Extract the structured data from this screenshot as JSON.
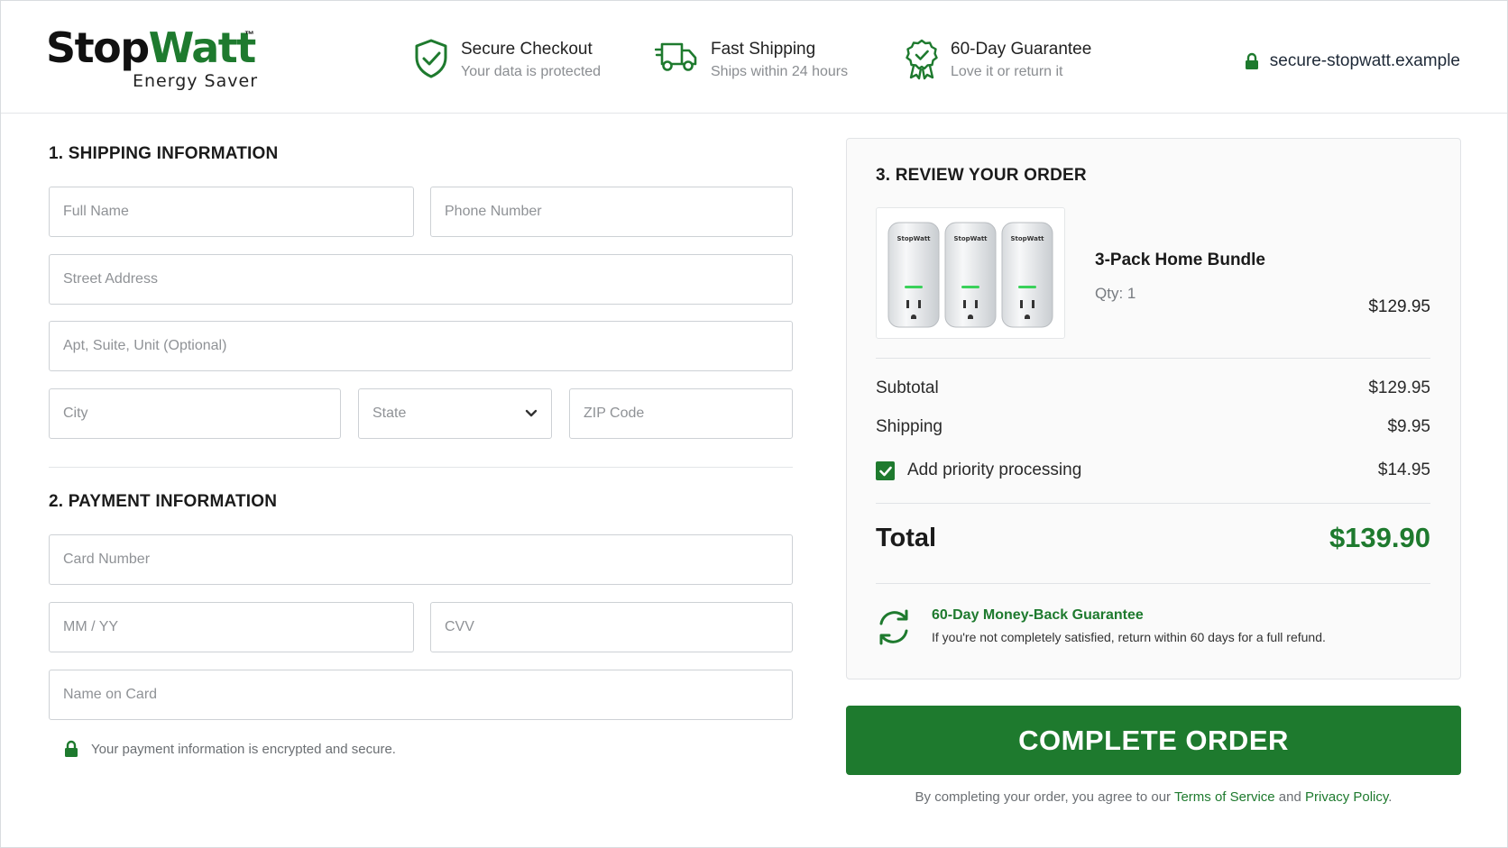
{
  "brand": {
    "logo_stop": "Stop",
    "logo_watt": "Watt",
    "logo_tm": "™",
    "logo_sub": "Energy Saver",
    "accent_color": "#1e7a2e"
  },
  "header": {
    "features": [
      {
        "icon": "shield-check-icon",
        "title": "Secure Checkout",
        "subtitle": "Your data is protected"
      },
      {
        "icon": "truck-icon",
        "title": "Fast Shipping",
        "subtitle": "Ships within 24 hours"
      },
      {
        "icon": "award-badge-icon",
        "title": "60-Day Guarantee",
        "subtitle": "Love it or return it"
      }
    ],
    "secure_url": "secure-stopwatt.example"
  },
  "shipping": {
    "heading": "1. SHIPPING INFORMATION",
    "full_name_placeholder": "Full Name",
    "phone_placeholder": "Phone Number",
    "street_placeholder": "Street Address",
    "apt_placeholder": "Apt, Suite, Unit (Optional)",
    "city_placeholder": "City",
    "state_value": "State",
    "zip_placeholder": "ZIP Code"
  },
  "payment": {
    "heading": "2. PAYMENT INFORMATION",
    "card_placeholder": "Card Number",
    "expiry_placeholder": "MM / YY",
    "cvv_placeholder": "CVV",
    "name_on_card_placeholder": "Name on Card",
    "secure_note": "Your payment information is encrypted and secure."
  },
  "order": {
    "heading": "3. REVIEW YOUR ORDER",
    "product_name": "3-Pack Home Bundle",
    "product_qty": "Qty: 1",
    "product_price": "$129.95",
    "device_label": "StopWatt",
    "subtotal_label": "Subtotal",
    "subtotal_value": "$129.95",
    "shipping_label": "Shipping",
    "shipping_value": "$9.95",
    "priority_label": "Add priority processing",
    "priority_value": "$14.95",
    "priority_checked": true,
    "total_label": "Total",
    "total_value": "$139.90",
    "guarantee_title": "60-Day Money-Back Guarantee",
    "guarantee_text": "If you're not completely satisfied, return within 60 days for a full refund."
  },
  "cta": {
    "complete_label": "COMPLETE ORDER",
    "legal_prefix": "By completing your order, you agree to our ",
    "terms_link": "Terms of Service",
    "legal_and": " and ",
    "privacy_link": "Privacy Policy",
    "legal_suffix": "."
  }
}
